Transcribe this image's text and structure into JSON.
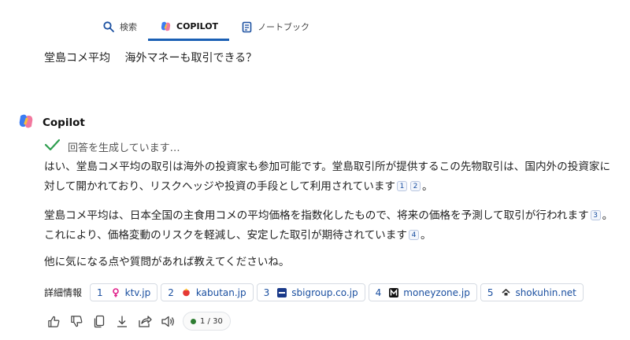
{
  "tabs": [
    {
      "label": "検索",
      "icon": "search-icon",
      "active": false
    },
    {
      "label": "COPILOT",
      "icon": "copilot-icon",
      "active": true
    },
    {
      "label": "ノートブック",
      "icon": "notebook-icon",
      "active": false
    }
  ],
  "question": "堂島コメ平均　 海外マネーも取引できる？",
  "copilot": {
    "name": "Copilot"
  },
  "status": {
    "text": "回答を生成しています…",
    "icon": "checkmark-icon"
  },
  "answer": {
    "p1": {
      "text_a": "はい、堂島コメ平均の取引は海外の投資家も参加可能です。堂島取引所が提供するこの先物取引は、国内外の投資家に対して開かれており、リスクヘッジや投資の手段として利用されています",
      "cite_1": "1",
      "cite_2": "2",
      "text_end": "。"
    },
    "p2": {
      "text_a": "堂島コメ平均は、日本全国の主食用コメの平均価格を指数化したもので、将来の価格を予測して取引が行われます",
      "cite_3": "3",
      "text_b": "。これにより、価格変動のリスクを軽減し、安定した取引が期待されています",
      "cite_4": "4",
      "text_end": "。"
    },
    "p3": {
      "text": "他に気になる点や質問があれば教えてくださいね。"
    }
  },
  "sources": {
    "label": "詳細情報",
    "items": [
      {
        "num": "1",
        "site": "ktv.jp",
        "icon": "ktv-favicon",
        "color": "#e0218a"
      },
      {
        "num": "2",
        "site": "kabutan.jp",
        "icon": "kabutan-favicon",
        "color": "#e53935"
      },
      {
        "num": "3",
        "site": "sbigroup.co.jp",
        "icon": "sbi-favicon",
        "color": "#1a3a8a"
      },
      {
        "num": "4",
        "site": "moneyzone.jp",
        "icon": "moneyzone-favicon",
        "color": "#111111"
      },
      {
        "num": "5",
        "site": "shokuhin.net",
        "icon": "shokuhin-favicon",
        "color": "#333333"
      }
    ]
  },
  "actions": {
    "counter": "1 / 30",
    "icons": [
      "thumbs-up-icon",
      "thumbs-down-icon",
      "copy-icon",
      "download-icon",
      "share-icon",
      "speaker-icon"
    ]
  },
  "colors": {
    "accent": "#1a5fb4",
    "link": "#1a4fa0",
    "check": "#2e9e4f",
    "status_dot": "#2e7d32"
  }
}
